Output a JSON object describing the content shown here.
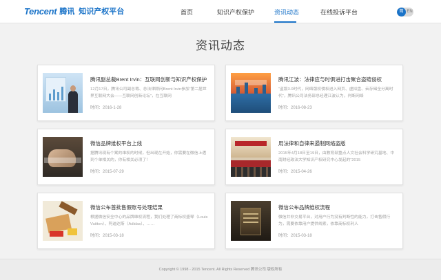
{
  "header": {
    "logo_word": "Tencent",
    "logo_cn": "腾讯",
    "logo_sub": "知识产权平台",
    "nav": [
      {
        "label": "首页",
        "active": false
      },
      {
        "label": "知识产权保护",
        "active": false
      },
      {
        "label": "资讯动态",
        "active": true
      },
      {
        "label": "在线投诉平台",
        "active": false
      }
    ],
    "lang_on": "简",
    "lang_off": "EN"
  },
  "page_title": "资讯动态",
  "articles": [
    {
      "title": "腾讯副总裁Brent Irvin：互联网创新与知识产权保护",
      "desc": "12月17日，腾讯公司副总裁、总法律顾问Brent Irvin参加“第二届世界互联网大会——互联网创新论坛”，在互联网",
      "time": "时间：2016-1-28"
    },
    {
      "title": "腾讯江波：法律应与时俱进打击聚合盗链侵权",
      "desc": "“盗版3.0时代，网络版权侵权进入网页、虚拟盘、云存储全分离时代”，腾讯公司法务部总经理江波认为，判断网络",
      "time": "时间：2016-08-23"
    },
    {
      "title": "微信品牌维权平台上线",
      "desc": "据腾讯现有个案的维权的时候，但出现在开始，你需要在微信上遇到个单相关的，你有相关必须了！",
      "time": "时间：2015-07-29"
    },
    {
      "title": "用法律和自律来遏制网络盗版",
      "desc": "2015年4月18日至19日，由教育部重点人文社会科学研究基地、中南财经政法大学知识产权研究中心发起的“2015",
      "time": "时间：2015-04-26"
    },
    {
      "title": "微信公布首批售假账号处理结果",
      "desc": "根据微信安全中心的品牌维权流程，我们处理了商标权盛琴（Louis Vuitton）、阿迪达斯（Adidas）、……",
      "time": "时间：2015-03-18"
    },
    {
      "title": "微信公布品牌维权流程",
      "desc": "微信并非交易平台，对用户行为没有判断性的能力，打击售假行为，需要依靠用户提供线索，依靠商标权利人",
      "time": "时间：2015-03-18"
    }
  ],
  "footer": {
    "text": "Copyright © 1998 - 2015 Tencent. All Rights Reserved 腾讯公司 版权所有"
  },
  "colors": {
    "accent": "#1a73c8",
    "background": "#f2f2f2"
  }
}
